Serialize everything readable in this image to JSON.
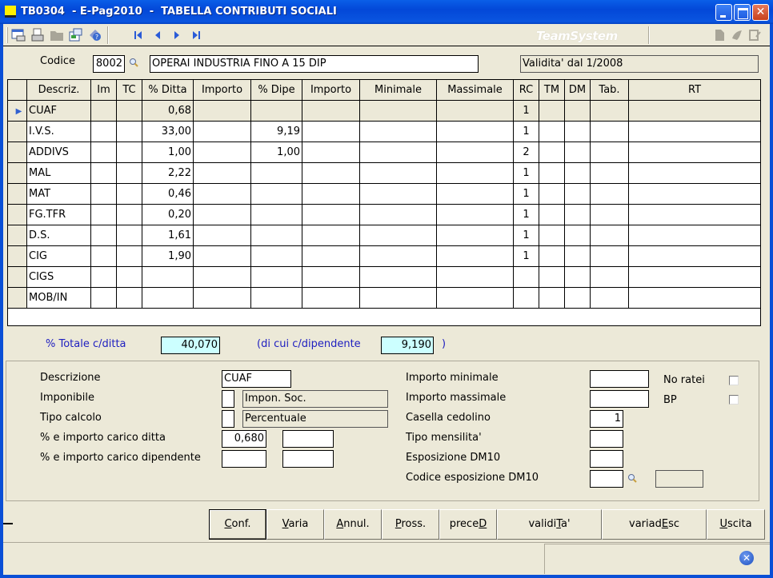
{
  "window": {
    "title": "TB0304  - E-Pag2010  -  TABELLA CONTRIBUTI SOCIALI",
    "minimize": "_",
    "maximize": "□",
    "close": "✕"
  },
  "toolbar": {
    "icons": [
      "print-preview-icon",
      "print-icon",
      "folder-icon",
      "export-icon",
      "help-icon"
    ],
    "nav": {
      "first": "⏮",
      "prev": "◀",
      "next": "▶",
      "last": "⏭"
    },
    "brand": "TeamSystem",
    "right_icons": [
      "document-icon",
      "arrow-icon",
      "notes-icon"
    ]
  },
  "header": {
    "codice_label": "Codice",
    "codice_value": "8002",
    "description_value": "OPERAI INDUSTRIA FINO A 15 DIP",
    "validity": "Validita' dal 1/2008"
  },
  "grid": {
    "columns": [
      "",
      "Descriz.",
      "Im",
      "TC",
      "% Ditta",
      "Importo",
      "% Dipe",
      "Importo",
      "Minimale",
      "Massimale",
      "RC",
      "TM",
      "DM",
      "Tab.",
      "RT"
    ],
    "rows": [
      {
        "current": true,
        "cells": [
          "",
          "CUAF",
          "",
          "",
          "0,68",
          "",
          "",
          "",
          "",
          "",
          "1",
          "",
          "",
          "",
          ""
        ]
      },
      {
        "current": false,
        "cells": [
          "",
          "I.V.S.",
          "",
          "",
          "33,00",
          "",
          "9,19",
          "",
          "",
          "",
          "1",
          "",
          "",
          "",
          ""
        ]
      },
      {
        "current": false,
        "cells": [
          "",
          "ADDIVS",
          "",
          "",
          "1,00",
          "",
          "1,00",
          "",
          "",
          "",
          "2",
          "",
          "",
          "",
          ""
        ]
      },
      {
        "current": false,
        "cells": [
          "",
          "MAL",
          "",
          "",
          "2,22",
          "",
          "",
          "",
          "",
          "",
          "1",
          "",
          "",
          "",
          ""
        ]
      },
      {
        "current": false,
        "cells": [
          "",
          "MAT",
          "",
          "",
          "0,46",
          "",
          "",
          "",
          "",
          "",
          "1",
          "",
          "",
          "",
          ""
        ]
      },
      {
        "current": false,
        "cells": [
          "",
          "FG.TFR",
          "",
          "",
          "0,20",
          "",
          "",
          "",
          "",
          "",
          "1",
          "",
          "",
          "",
          ""
        ]
      },
      {
        "current": false,
        "cells": [
          "",
          "D.S.",
          "",
          "",
          "1,61",
          "",
          "",
          "",
          "",
          "",
          "1",
          "",
          "",
          "",
          ""
        ]
      },
      {
        "current": false,
        "cells": [
          "",
          "CIG",
          "",
          "",
          "1,90",
          "",
          "",
          "",
          "",
          "",
          "1",
          "",
          "",
          "",
          ""
        ]
      },
      {
        "current": false,
        "cells": [
          "",
          "CIGS",
          "",
          "",
          "",
          "",
          "",
          "",
          "",
          "",
          "",
          "",
          "",
          "",
          ""
        ]
      },
      {
        "current": false,
        "cells": [
          "",
          "MOB/IN",
          "",
          "",
          "",
          "",
          "",
          "",
          "",
          "",
          "",
          "",
          "",
          "",
          ""
        ]
      }
    ]
  },
  "totals": {
    "ditta_label": "% Totale c/ditta",
    "ditta_value": "40,070",
    "dip_label": "(di cui c/dipendente",
    "dip_value": "9,190",
    "close_paren": ")"
  },
  "detail": {
    "descrizione_label": "Descrizione",
    "descrizione_value": "CUAF",
    "imponibile_label": "Imponibile",
    "imponibile_code": "",
    "imponibile_desc": "Impon. Soc.",
    "tipo_calcolo_label": "Tipo calcolo",
    "tipo_calcolo_code": "",
    "tipo_calcolo_desc": "Percentuale",
    "carico_ditta_label": "% e importo carico ditta",
    "carico_ditta_pct": "0,680",
    "carico_ditta_imp": "",
    "carico_dip_label": "% e importo carico dipendente",
    "carico_dip_pct": "",
    "carico_dip_imp": "",
    "importo_min_label": "Importo minimale",
    "importo_min_value": "",
    "importo_max_label": "Importo massimale",
    "importo_max_value": "",
    "casella_label": "Casella cedolino",
    "casella_value": "1",
    "tipo_mens_label": "Tipo mensilita'",
    "tipo_mens_value": "",
    "esp_dm10_label": "Esposizione DM10",
    "esp_dm10_value": "",
    "cod_esp_dm10_label": "Codice esposizione DM10",
    "cod_esp_dm10_value": "",
    "cod_esp_dm10_desc": "",
    "no_ratei_label": "No ratei",
    "no_ratei_checked": false,
    "bp_label": "BP",
    "bp_checked": false
  },
  "buttons": [
    {
      "id": "conf",
      "pre": "",
      "key": "C",
      "post": "onf."
    },
    {
      "id": "varia",
      "pre": "",
      "key": "V",
      "post": "aria"
    },
    {
      "id": "annul",
      "pre": "",
      "key": "A",
      "post": "nnul."
    },
    {
      "id": "pross",
      "pre": "",
      "key": "P",
      "post": "ross."
    },
    {
      "id": "preced",
      "pre": "prece",
      "key": "D",
      "post": ""
    },
    {
      "id": "validita",
      "pre": "validi",
      "key": "T",
      "post": "a'"
    },
    {
      "id": "variadesc",
      "pre": "variad",
      "key": "E",
      "post": "sc"
    },
    {
      "id": "uscita",
      "pre": "",
      "key": "U",
      "post": "scita"
    }
  ],
  "status": {
    "left": "",
    "right": ""
  }
}
